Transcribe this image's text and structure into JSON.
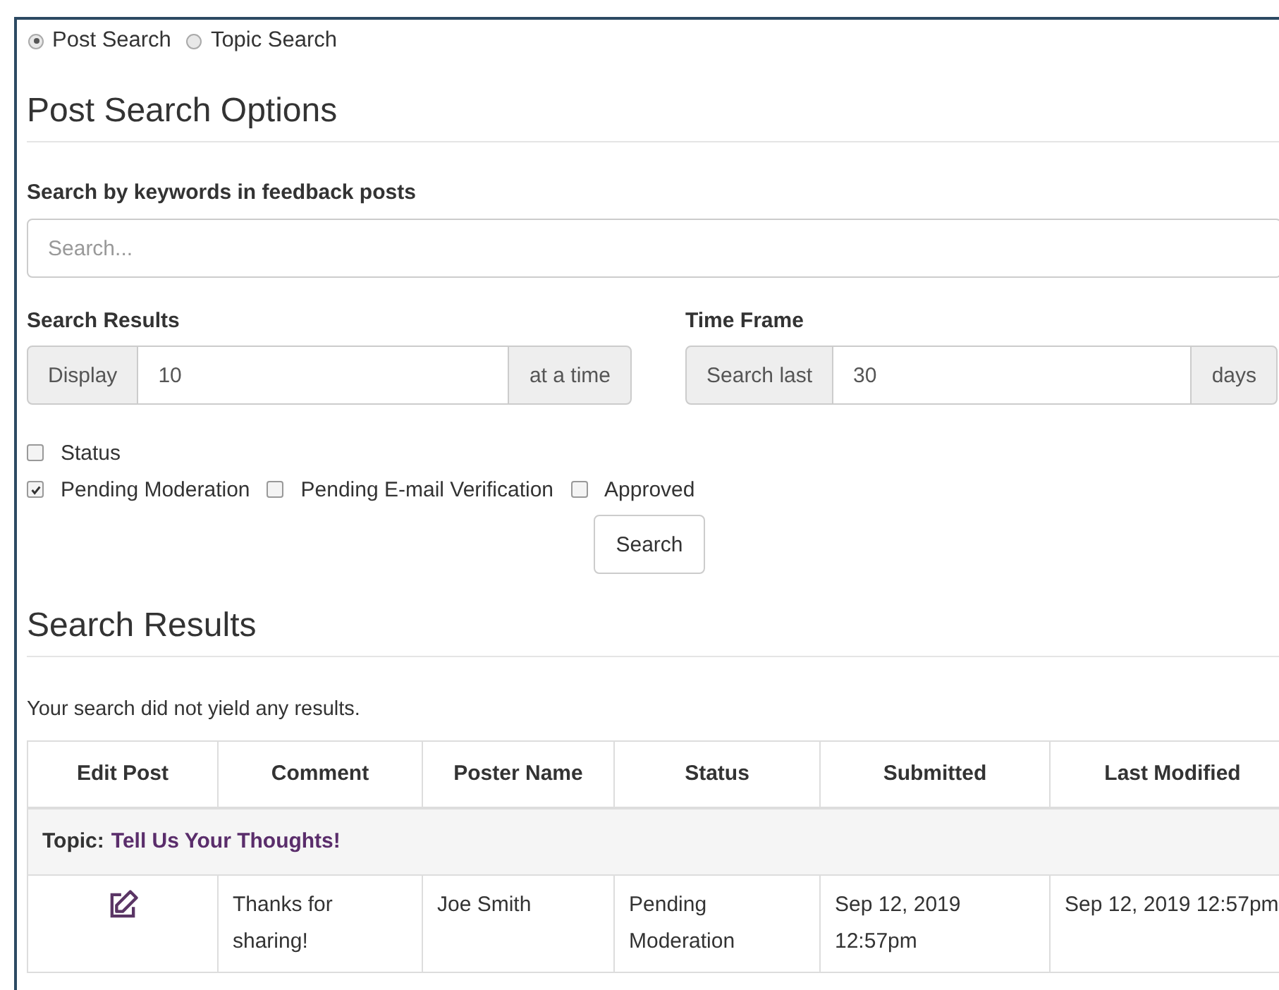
{
  "search_modes": [
    {
      "label": "Post Search",
      "selected": true
    },
    {
      "label": "Topic Search",
      "selected": false
    }
  ],
  "options_heading": "Post Search Options",
  "keywords": {
    "label": "Search by keywords in feedback posts",
    "placeholder": "Search..."
  },
  "search_results_setting": {
    "label": "Search Results",
    "prefix": "Display",
    "value": "10",
    "suffix": "at a time"
  },
  "time_frame": {
    "label": "Time Frame",
    "prefix": "Search last",
    "value": "30",
    "suffix": "days"
  },
  "status_filter": {
    "label": "Status",
    "checked": false,
    "options": [
      {
        "label": "Pending Moderation",
        "checked": true
      },
      {
        "label": "Pending E-mail Verification",
        "checked": false
      },
      {
        "label": "Approved",
        "checked": false
      }
    ]
  },
  "search_button": "Search",
  "results_heading": "Search Results",
  "results_message": "Your search did not yield any results.",
  "table": {
    "columns": [
      "Edit Post",
      "Comment",
      "Poster Name",
      "Status",
      "Submitted",
      "Last Modified"
    ],
    "groups": [
      {
        "label": "Topic:",
        "title": "Tell Us Your Thoughts!",
        "rows": [
          {
            "comment": "Thanks for sharing!",
            "poster": "Joe Smith",
            "status": "Pending Moderation",
            "submitted": "Sep 12, 2019 12:57pm",
            "modified": "Sep 12, 2019 12:57pm"
          }
        ]
      }
    ]
  }
}
